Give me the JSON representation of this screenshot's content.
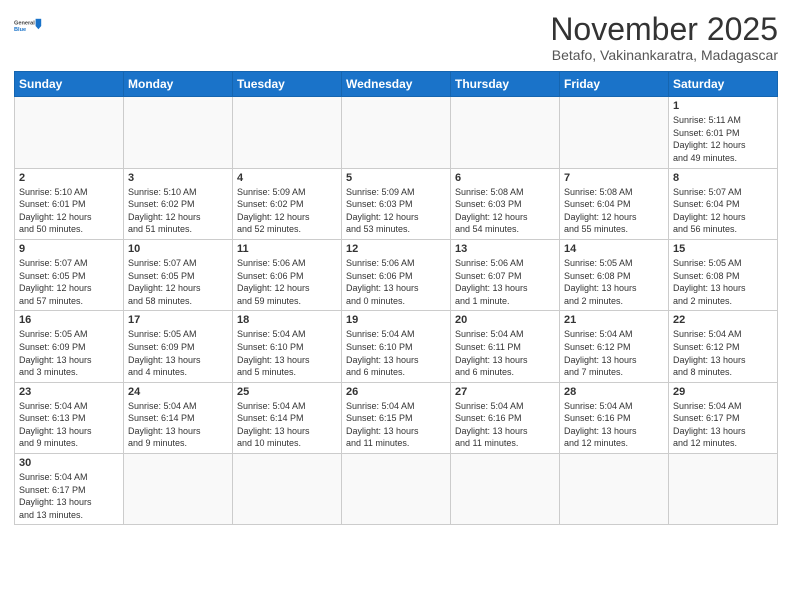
{
  "logo": {
    "general": "General",
    "blue": "Blue"
  },
  "header": {
    "month": "November 2025",
    "location": "Betafo, Vakinankaratra, Madagascar"
  },
  "days_of_week": [
    "Sunday",
    "Monday",
    "Tuesday",
    "Wednesday",
    "Thursday",
    "Friday",
    "Saturday"
  ],
  "weeks": [
    [
      {
        "day": "",
        "info": ""
      },
      {
        "day": "",
        "info": ""
      },
      {
        "day": "",
        "info": ""
      },
      {
        "day": "",
        "info": ""
      },
      {
        "day": "",
        "info": ""
      },
      {
        "day": "",
        "info": ""
      },
      {
        "day": "1",
        "info": "Sunrise: 5:11 AM\nSunset: 6:01 PM\nDaylight: 12 hours\nand 49 minutes."
      }
    ],
    [
      {
        "day": "2",
        "info": "Sunrise: 5:10 AM\nSunset: 6:01 PM\nDaylight: 12 hours\nand 50 minutes."
      },
      {
        "day": "3",
        "info": "Sunrise: 5:10 AM\nSunset: 6:02 PM\nDaylight: 12 hours\nand 51 minutes."
      },
      {
        "day": "4",
        "info": "Sunrise: 5:09 AM\nSunset: 6:02 PM\nDaylight: 12 hours\nand 52 minutes."
      },
      {
        "day": "5",
        "info": "Sunrise: 5:09 AM\nSunset: 6:03 PM\nDaylight: 12 hours\nand 53 minutes."
      },
      {
        "day": "6",
        "info": "Sunrise: 5:08 AM\nSunset: 6:03 PM\nDaylight: 12 hours\nand 54 minutes."
      },
      {
        "day": "7",
        "info": "Sunrise: 5:08 AM\nSunset: 6:04 PM\nDaylight: 12 hours\nand 55 minutes."
      },
      {
        "day": "8",
        "info": "Sunrise: 5:07 AM\nSunset: 6:04 PM\nDaylight: 12 hours\nand 56 minutes."
      }
    ],
    [
      {
        "day": "9",
        "info": "Sunrise: 5:07 AM\nSunset: 6:05 PM\nDaylight: 12 hours\nand 57 minutes."
      },
      {
        "day": "10",
        "info": "Sunrise: 5:07 AM\nSunset: 6:05 PM\nDaylight: 12 hours\nand 58 minutes."
      },
      {
        "day": "11",
        "info": "Sunrise: 5:06 AM\nSunset: 6:06 PM\nDaylight: 12 hours\nand 59 minutes."
      },
      {
        "day": "12",
        "info": "Sunrise: 5:06 AM\nSunset: 6:06 PM\nDaylight: 13 hours\nand 0 minutes."
      },
      {
        "day": "13",
        "info": "Sunrise: 5:06 AM\nSunset: 6:07 PM\nDaylight: 13 hours\nand 1 minute."
      },
      {
        "day": "14",
        "info": "Sunrise: 5:05 AM\nSunset: 6:08 PM\nDaylight: 13 hours\nand 2 minutes."
      },
      {
        "day": "15",
        "info": "Sunrise: 5:05 AM\nSunset: 6:08 PM\nDaylight: 13 hours\nand 2 minutes."
      }
    ],
    [
      {
        "day": "16",
        "info": "Sunrise: 5:05 AM\nSunset: 6:09 PM\nDaylight: 13 hours\nand 3 minutes."
      },
      {
        "day": "17",
        "info": "Sunrise: 5:05 AM\nSunset: 6:09 PM\nDaylight: 13 hours\nand 4 minutes."
      },
      {
        "day": "18",
        "info": "Sunrise: 5:04 AM\nSunset: 6:10 PM\nDaylight: 13 hours\nand 5 minutes."
      },
      {
        "day": "19",
        "info": "Sunrise: 5:04 AM\nSunset: 6:10 PM\nDaylight: 13 hours\nand 6 minutes."
      },
      {
        "day": "20",
        "info": "Sunrise: 5:04 AM\nSunset: 6:11 PM\nDaylight: 13 hours\nand 6 minutes."
      },
      {
        "day": "21",
        "info": "Sunrise: 5:04 AM\nSunset: 6:12 PM\nDaylight: 13 hours\nand 7 minutes."
      },
      {
        "day": "22",
        "info": "Sunrise: 5:04 AM\nSunset: 6:12 PM\nDaylight: 13 hours\nand 8 minutes."
      }
    ],
    [
      {
        "day": "23",
        "info": "Sunrise: 5:04 AM\nSunset: 6:13 PM\nDaylight: 13 hours\nand 9 minutes."
      },
      {
        "day": "24",
        "info": "Sunrise: 5:04 AM\nSunset: 6:14 PM\nDaylight: 13 hours\nand 9 minutes."
      },
      {
        "day": "25",
        "info": "Sunrise: 5:04 AM\nSunset: 6:14 PM\nDaylight: 13 hours\nand 10 minutes."
      },
      {
        "day": "26",
        "info": "Sunrise: 5:04 AM\nSunset: 6:15 PM\nDaylight: 13 hours\nand 11 minutes."
      },
      {
        "day": "27",
        "info": "Sunrise: 5:04 AM\nSunset: 6:16 PM\nDaylight: 13 hours\nand 11 minutes."
      },
      {
        "day": "28",
        "info": "Sunrise: 5:04 AM\nSunset: 6:16 PM\nDaylight: 13 hours\nand 12 minutes."
      },
      {
        "day": "29",
        "info": "Sunrise: 5:04 AM\nSunset: 6:17 PM\nDaylight: 13 hours\nand 12 minutes."
      }
    ],
    [
      {
        "day": "30",
        "info": "Sunrise: 5:04 AM\nSunset: 6:17 PM\nDaylight: 13 hours\nand 13 minutes."
      },
      {
        "day": "",
        "info": ""
      },
      {
        "day": "",
        "info": ""
      },
      {
        "day": "",
        "info": ""
      },
      {
        "day": "",
        "info": ""
      },
      {
        "day": "",
        "info": ""
      },
      {
        "day": "",
        "info": ""
      }
    ]
  ]
}
